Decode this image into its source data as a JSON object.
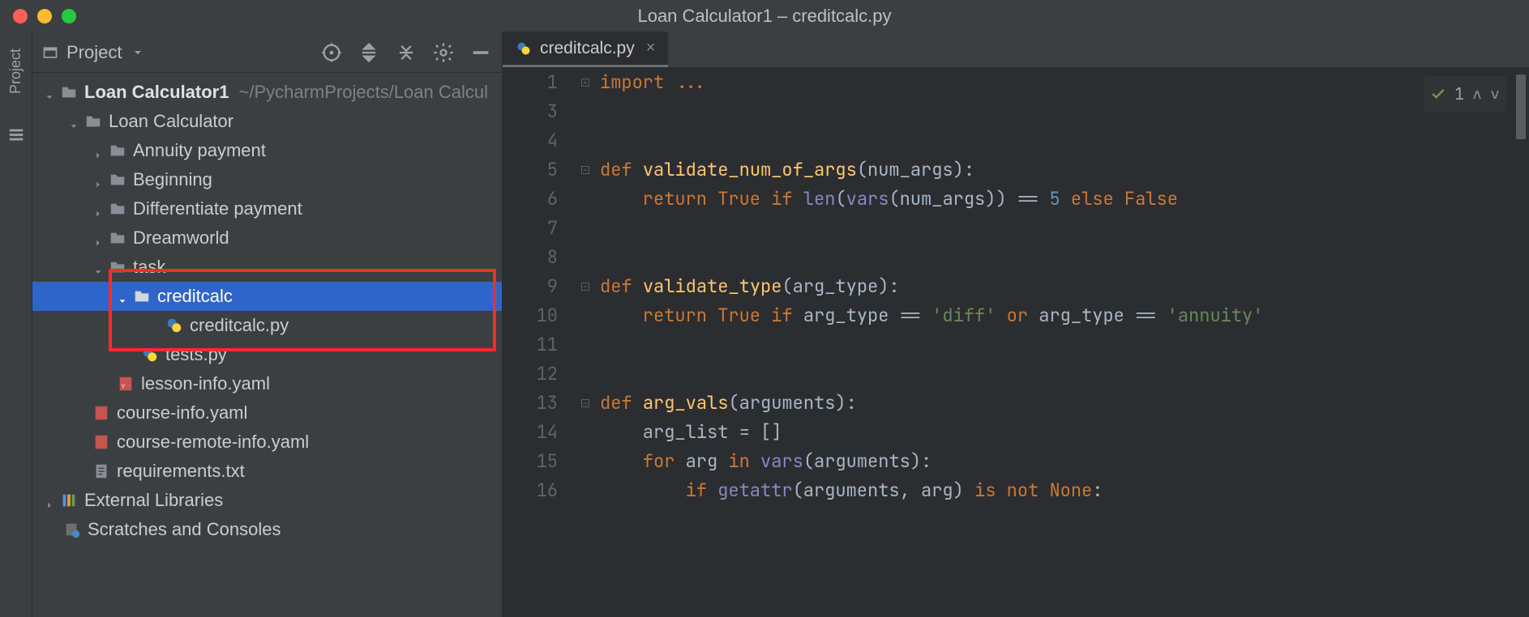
{
  "window": {
    "title": "Loan Calculator1 – creditcalc.py"
  },
  "left_rail": {
    "project_label": "Project"
  },
  "project_panel": {
    "title": "Project",
    "root": {
      "label": "Loan Calculator1",
      "path": "~/PycharmProjects/Loan Calcul"
    },
    "tree": {
      "loan_calc": "Loan Calculator",
      "annuity": "Annuity payment",
      "beginning": "Beginning",
      "diff": "Differentiate payment",
      "dream": "Dreamworld",
      "task": "task",
      "creditcalc_dir": "creditcalc",
      "creditcalc_py": "creditcalc.py",
      "tests_py": "tests.py",
      "lesson_info": "lesson-info.yaml",
      "course_info": "course-info.yaml",
      "course_remote": "course-remote-info.yaml",
      "requirements": "requirements.txt",
      "external": "External Libraries",
      "scratches": "Scratches and Consoles"
    }
  },
  "tab": {
    "label": "creditcalc.py"
  },
  "inspection": {
    "count": "1"
  },
  "code": {
    "l1": "import ...",
    "l3": "",
    "l4": "",
    "l5a": "def ",
    "l5b": "validate_num_of_args",
    "l5c": "(num_args):",
    "l6a": "    return ",
    "l6b": "True ",
    "l6c": "if ",
    "l6d": "len",
    "l6e": "(",
    "l6f": "vars",
    "l6g": "(num_args)) == ",
    "l6h": "5 ",
    "l6i": "else ",
    "l6j": "False",
    "l7": "",
    "l8": "",
    "l9a": "def ",
    "l9b": "validate_type",
    "l9c": "(arg_type):",
    "l10a": "    return ",
    "l10b": "True ",
    "l10c": "if ",
    "l10d": "arg_type == ",
    "l10e": "'diff' ",
    "l10f": "or ",
    "l10g": "arg_type == ",
    "l10h": "'annuity'",
    "l11": "",
    "l12": "",
    "l13a": "def ",
    "l13b": "arg_vals",
    "l13c": "(arguments):",
    "l14": "    arg_list = []",
    "l15a": "    for ",
    "l15b": "arg ",
    "l15c": "in ",
    "l15d": "vars",
    "l15e": "(arguments):",
    "l16a": "        if ",
    "l16b": "getattr",
    "l16c": "(arguments",
    "l16d": ", ",
    "l16e": "arg) ",
    "l16f": "is not ",
    "l16g": "None",
    "l16h": ":"
  },
  "gutter": [
    "1",
    "3",
    "4",
    "5",
    "6",
    "7",
    "8",
    "9",
    "10",
    "11",
    "12",
    "13",
    "14",
    "15",
    "16"
  ]
}
